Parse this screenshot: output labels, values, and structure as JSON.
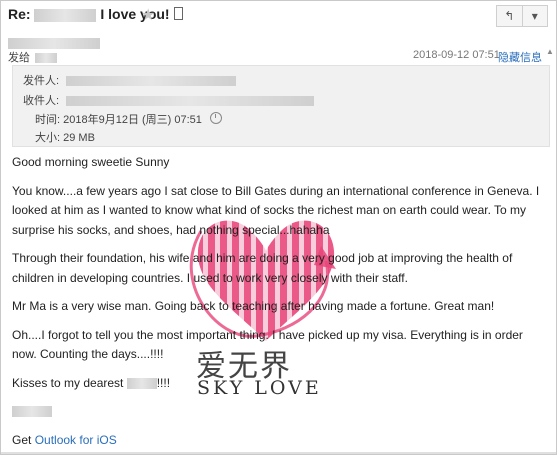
{
  "header": {
    "subject_prefix": "Re:",
    "subject_suffix": "I love you!",
    "star_icon": "star-icon",
    "nav_up_label": "↰",
    "nav_down_label": "▾",
    "send_to_label": "发给",
    "date": "2018-09-12 07:51",
    "hide_label": "隐藏信息"
  },
  "details": {
    "from_label": "发件人:",
    "to_label": "收件人:",
    "time_label": "时间:",
    "time_value": "2018年9月12日 (周三) 07:51",
    "size_label": "大小:",
    "size_value": "29 MB"
  },
  "message": {
    "greeting": "Good morning sweetie Sunny",
    "para1": "You know....a few years ago I sat close to Bill Gates during an international conference in Geneva. I looked at him as I wanted to know what kind of socks the richest man on earth could wear. To my surprise his socks, and shoes, had nothing special...hahaha",
    "para2": "Through their foundation, his wife and him are doing a very good job at improving the health of children in developing countries. I used to work very closely with their staff.",
    "para3": "Mr Ma is a very wise man. Going back to teaching after having made a fortune. Great man!",
    "para4": "Oh....I forgot to tell you the most important thing. I have picked up my visa. Everything is in order now. Counting the days....!!!!",
    "kisses_prefix": "Kisses to my dearest",
    "kisses_suffix": "!!!!",
    "get_prefix": "Get",
    "outlook_link": "Outlook for iOS"
  },
  "watermark": {
    "cn": "爱无界",
    "en": "SKY LOVE",
    "color": "#e8457a"
  }
}
